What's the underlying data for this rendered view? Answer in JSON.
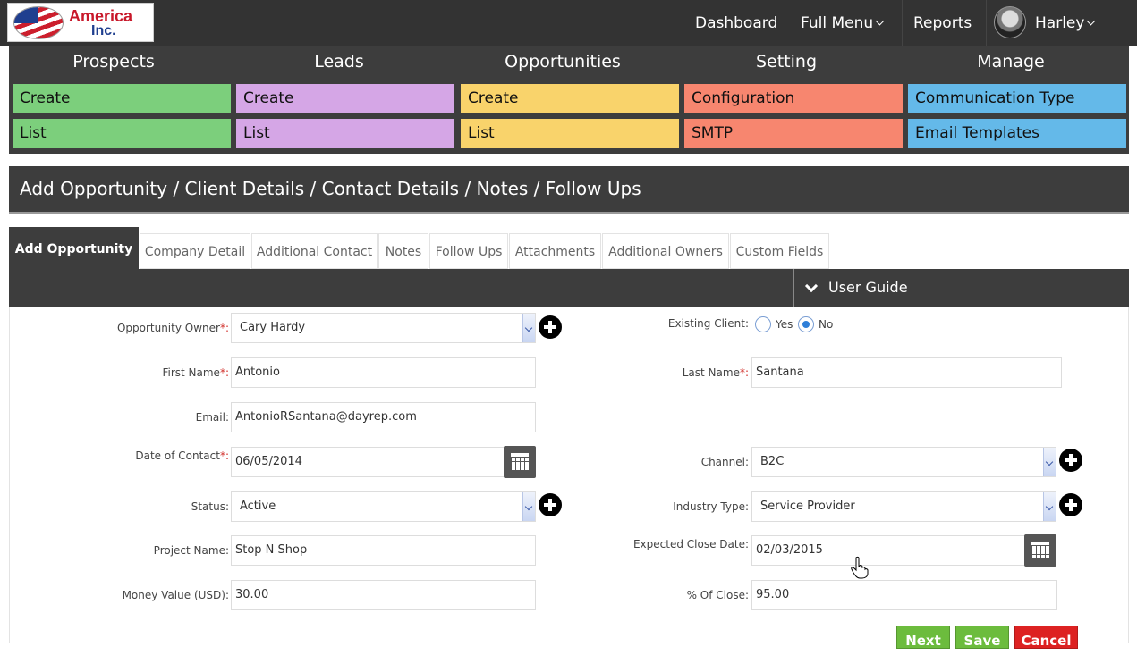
{
  "brand": {
    "line1": "America",
    "line2": "Inc."
  },
  "topnav": {
    "dashboard": "Dashboard",
    "full_menu": "Full Menu",
    "reports": "Reports",
    "user": "Harley"
  },
  "modules": [
    {
      "title": "Prospects",
      "items": [
        "Create",
        "List"
      ],
      "color": "#7ccf7c"
    },
    {
      "title": "Leads",
      "items": [
        "Create",
        "List"
      ],
      "color": "#d5a6e6"
    },
    {
      "title": "Opportunities",
      "items": [
        "Create",
        "List"
      ],
      "color": "#f9d36b"
    },
    {
      "title": "Setting",
      "items": [
        "Configuration",
        "SMTP"
      ],
      "color": "#f7866f"
    },
    {
      "title": "Manage",
      "items": [
        "Communication Type",
        "Email Templates"
      ],
      "color": "#64b9e9"
    }
  ],
  "page_title": "Add Opportunity / Client Details / Contact Details / Notes / Follow Ups",
  "tabs": [
    "Add Opportunity",
    "Company Detail",
    "Additional Contact",
    "Notes",
    "Follow Ups",
    "Attachments",
    "Additional Owners",
    "Custom Fields"
  ],
  "user_guide": "User Guide",
  "form": {
    "opportunity_owner": {
      "label": "Opportunity Owner",
      "required": "*:",
      "value": "Cary Hardy"
    },
    "existing_client": {
      "label": "Existing Client:",
      "yes": "Yes",
      "no": "No",
      "selected": "No"
    },
    "first_name": {
      "label": "First Name",
      "required": "*:",
      "value": "Antonio"
    },
    "last_name": {
      "label": "Last Name",
      "required": "*:",
      "value": "Santana"
    },
    "email": {
      "label": "Email:",
      "value": "AntonioRSantana@dayrep.com"
    },
    "date_of_contact": {
      "label": "Date of Contact",
      "required": "*:",
      "value": "06/05/2014"
    },
    "channel": {
      "label": "Channel:",
      "value": "B2C"
    },
    "status": {
      "label": "Status:",
      "value": "Active"
    },
    "industry_type": {
      "label": "Industry Type:",
      "value": "Service Provider"
    },
    "project_name": {
      "label": "Project Name:",
      "value": "Stop N Shop"
    },
    "expected_close_date": {
      "label": "Expected Close Date:",
      "value": "02/03/2015"
    },
    "money_value": {
      "label": "Money Value (USD):",
      "value": "30.00"
    },
    "percent_close": {
      "label": "% Of Close:",
      "value": "95.00"
    }
  },
  "actions": {
    "next": "Next",
    "save": "Save",
    "cancel": "Cancel"
  }
}
